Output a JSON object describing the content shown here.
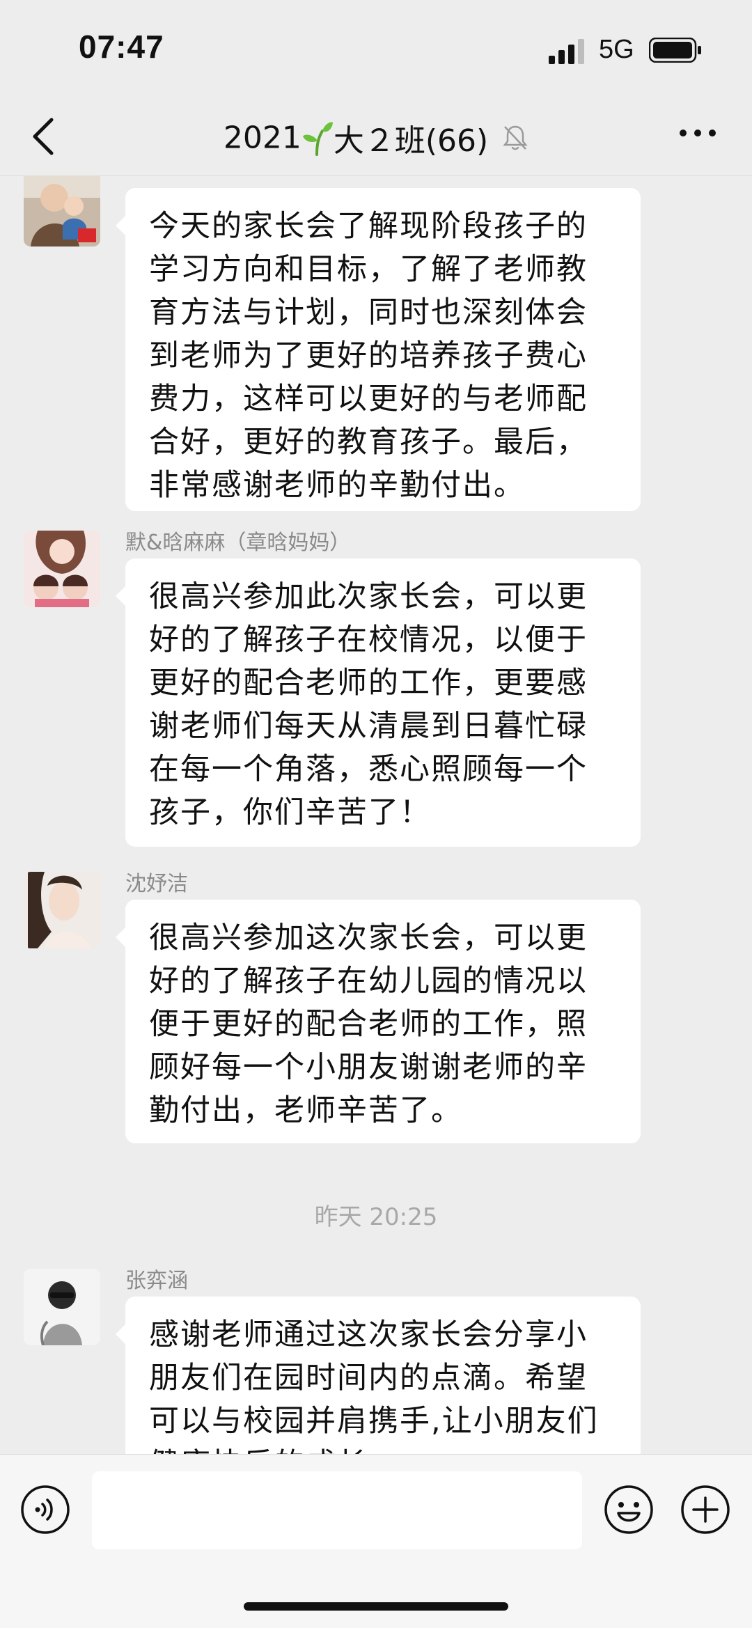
{
  "status_bar": {
    "time": "07:47",
    "network": "5G"
  },
  "header": {
    "title_prefix": "2021",
    "title_suffix": "大２班(66)",
    "icons": [
      "back-arrow",
      "sprout-emoji",
      "muted-bell",
      "more-dots"
    ]
  },
  "messages": [
    {
      "sender": "",
      "text": "今天的家长会了解现阶段孩子的学习方向和目标，了解了老师教育方法与计划，同时也深刻体会到老师为了更好的培养孩子费心费力，这样可以更好的与老师配合好，更好的教育孩子。最后，非常感谢老师的辛勤付出。"
    },
    {
      "sender": "默&晗麻麻（章晗妈妈）",
      "text": "很高兴参加此次家长会，可以更好的了解孩子在校情况，以便于更好的配合老师的工作，更要感谢老师们每天从清晨到日暮忙碌在每一个角落，悉心照顾每一个孩子，你们辛苦了！"
    },
    {
      "sender": "沈妤洁",
      "text": "很高兴参加这次家长会，可以更好的了解孩子在幼儿园的情况以便于更好的配合老师的工作，照顾好每一个小朋友谢谢老师的辛勤付出，老师辛苦了。"
    },
    {
      "sender": "张弈涵",
      "text": "感谢老师通过这次家长会分享小朋友们在园时间内的点滴。希望可以与校园并肩携手,让小朋友们健康快乐的成长。"
    }
  ],
  "timestamp": "昨天 20:25",
  "input_bar": {
    "value": "",
    "icons": [
      "voice-icon",
      "emoji-icon",
      "plus-icon"
    ]
  },
  "colors": {
    "background": "#ededed",
    "bubble": "#ffffff",
    "sender": "#8a8a8a",
    "timestamp": "#a8a8a8"
  }
}
